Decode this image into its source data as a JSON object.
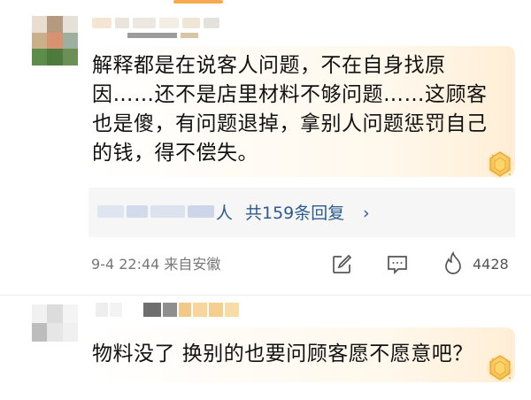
{
  "comment1": {
    "text": "解释都是在说客人问题，不在自身找原因……还不是店里材料不够问题……这顾客也是傻，有问题退掉，拿别人问题惩罚自己的钱，得不偿失。",
    "replies_suffix": "人",
    "replies_link": "共159条回复",
    "replies_chevron": "›",
    "timestamp": "9-4 22:44 来自安徽",
    "like_count": "4428"
  },
  "comment2": {
    "text": "物料没了 换别的也要问顾客愿不愿意吧？"
  },
  "colors": {
    "link": "#2d5b8e",
    "accent": "#f6a94e",
    "meta": "#777777"
  },
  "icons": {
    "edit": "edit-icon",
    "comment": "comment-icon",
    "like": "like-icon",
    "medal": "medal-icon"
  }
}
